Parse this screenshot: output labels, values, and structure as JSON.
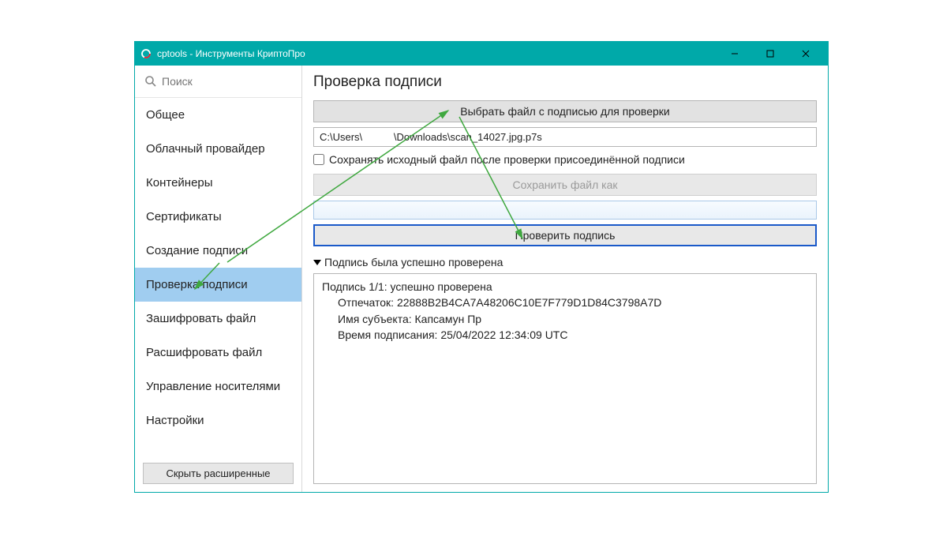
{
  "window": {
    "title": "cptools - Инструменты КриптоПро"
  },
  "search": {
    "placeholder": "Поиск"
  },
  "sidebar": {
    "items": [
      {
        "label": "Общее"
      },
      {
        "label": "Облачный провайдер"
      },
      {
        "label": "Контейнеры"
      },
      {
        "label": "Сертификаты"
      },
      {
        "label": "Создание подписи"
      },
      {
        "label": "Проверка подписи"
      },
      {
        "label": "Зашифровать файл"
      },
      {
        "label": "Расшифровать файл"
      },
      {
        "label": "Управление носителями"
      },
      {
        "label": "Настройки"
      }
    ],
    "active_index": 5,
    "hide_advanced_label": "Скрыть расширенные"
  },
  "main": {
    "title": "Проверка подписи",
    "select_file_button": "Выбрать файл с подписью для проверки",
    "file_path": "C:\\Users\\           \\Downloads\\scan_14027.jpg.p7s",
    "save_source_checkbox_label": "Сохранять исходный файл после проверки присоединённой подписи",
    "save_source_checked": false,
    "save_as_button": "Сохранить файл как",
    "save_as_path": "",
    "verify_button": "Проверить подпись",
    "result_header": "Подпись была успешно проверена",
    "result_lines": {
      "line1": "Подпись 1/1: успешно проверена",
      "thumbprint_label": "Отпечаток:",
      "thumbprint": "22888B2B4CA7A48206C10E7F779D1D84C3798A7D",
      "subject_label": "Имя субъекта:",
      "subject": "Капсамун Пр",
      "time_label": "Время подписания:",
      "time": "25/04/2022 12:34:09 UTC"
    }
  }
}
